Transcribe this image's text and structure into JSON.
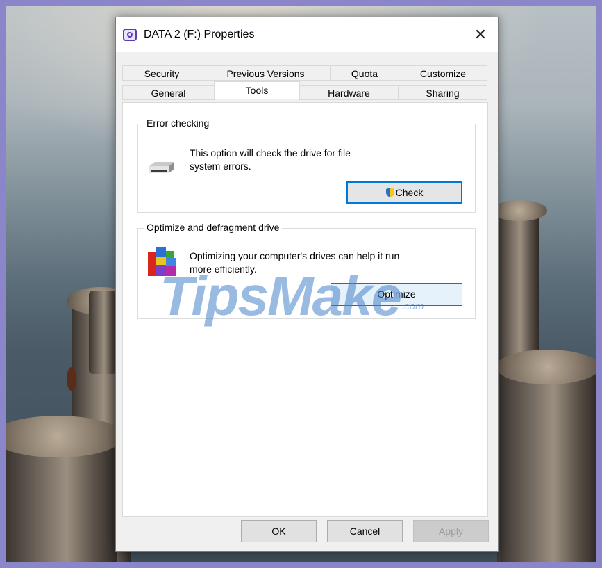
{
  "window": {
    "title": "DATA 2 (F:) Properties"
  },
  "tabs_row1": [
    "Security",
    "Previous Versions",
    "Quota",
    "Customize"
  ],
  "tabs_row2": [
    "General",
    "Tools",
    "Hardware",
    "Sharing"
  ],
  "active_tab": "Tools",
  "error_checking": {
    "title": "Error checking",
    "description_line1": "This option will check the drive for file",
    "description_line2": "system errors.",
    "button_label": "Check"
  },
  "optimize": {
    "title": "Optimize and defragment drive",
    "description_line1": "Optimizing your computer's drives can help it run",
    "description_line2": "more efficiently.",
    "button_label": "Optimize"
  },
  "footer": {
    "ok": "OK",
    "cancel": "Cancel",
    "apply": "Apply"
  },
  "watermark": {
    "main": "TipsMake",
    "sub": ".com"
  },
  "colors": {
    "accent": "#0078d7",
    "dialog_bg": "#f0f0f0",
    "frame": "#8a86c9"
  }
}
